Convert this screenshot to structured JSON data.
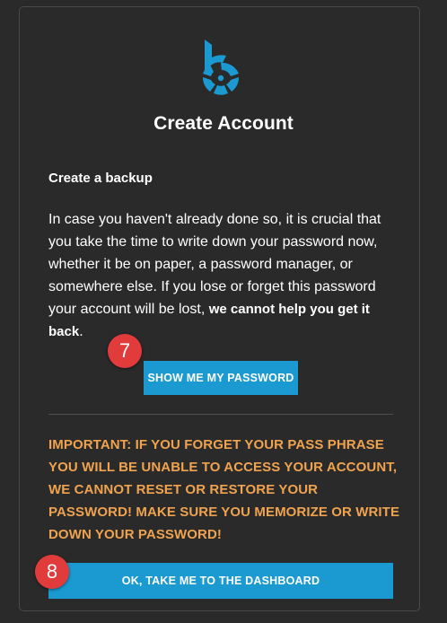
{
  "brand": {
    "logo_icon": "hive-blurt-b-logo-icon",
    "accent_color": "#1a9ad1"
  },
  "card": {
    "title": "Create Account",
    "subtitle": "Create a backup",
    "body_text": "In case you haven't already done so, it is crucial that you take the time to write down your password now, whether it be on paper, a password manager, or somewhere else. If you lose or forget this password your account will be lost, ",
    "body_bold": "we cannot help you get it back",
    "body_end": ".",
    "show_password_label": "SHOW ME MY PASSWORD",
    "warning_text": "IMPORTANT: IF YOU FORGET YOUR PASS PHRASE YOU WILL BE UNABLE TO ACCESS YOUR ACCOUNT, WE CANNOT RESET OR RESTORE YOUR PASSWORD! MAKE SURE YOU MEMORIZE OR WRITE DOWN YOUR PASSWORD!",
    "warning_color": "#f0a34f",
    "dashboard_label": "OK, TAKE ME TO THE DASHBOARD"
  },
  "annotations": {
    "badge_7": "7",
    "badge_8": "8",
    "badge_color": "#e23b3b"
  }
}
